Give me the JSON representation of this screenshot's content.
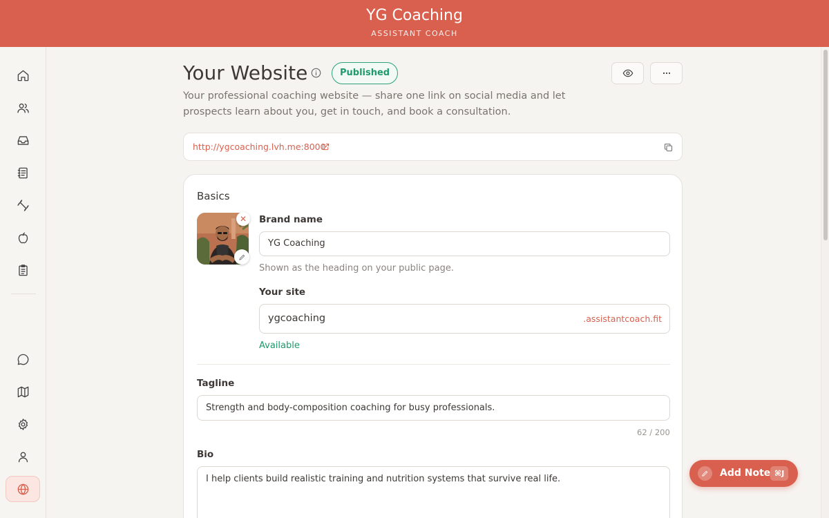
{
  "topbar": {
    "brand": "YG Coaching",
    "subtitle": "ASSISTANT COACH",
    "color": "#d9604e"
  },
  "sidebar": {
    "items": [
      {
        "icon": "home-icon"
      },
      {
        "icon": "users-icon"
      },
      {
        "icon": "inbox-icon"
      },
      {
        "icon": "notebook-icon"
      },
      {
        "icon": "dumbbell-icon"
      },
      {
        "icon": "apple-icon"
      },
      {
        "icon": "clipboard-icon"
      },
      {
        "icon": "chat-icon"
      },
      {
        "icon": "map-icon"
      },
      {
        "icon": "gear-icon"
      },
      {
        "icon": "user-icon"
      },
      {
        "icon": "globe-icon",
        "active": true
      }
    ]
  },
  "header": {
    "title": "Your Website",
    "status": "Published",
    "status_color": "#1f9a6b",
    "description": "Your professional coaching website — share one link on social media and let prospects learn about you, get in touch, and book a consultation."
  },
  "url": {
    "value": "http://ygcoaching.lvh.me:8000"
  },
  "basics": {
    "section_title": "Basics",
    "brand_name": {
      "label": "Brand name",
      "value": "YG Coaching",
      "hint": "Shown as the heading on your public page."
    },
    "site": {
      "label": "Your site",
      "value": "ygcoaching",
      "suffix": ".assistantcoach.fit",
      "status": "Available"
    },
    "tagline": {
      "label": "Tagline",
      "value": "Strength and body-composition coaching for busy professionals.",
      "counter": "62 / 200"
    },
    "bio": {
      "label": "Bio",
      "value": "I help clients build realistic training and nutrition systems that survive real life."
    }
  },
  "fab": {
    "label": "Add Note",
    "shortcut": "⌘J"
  }
}
